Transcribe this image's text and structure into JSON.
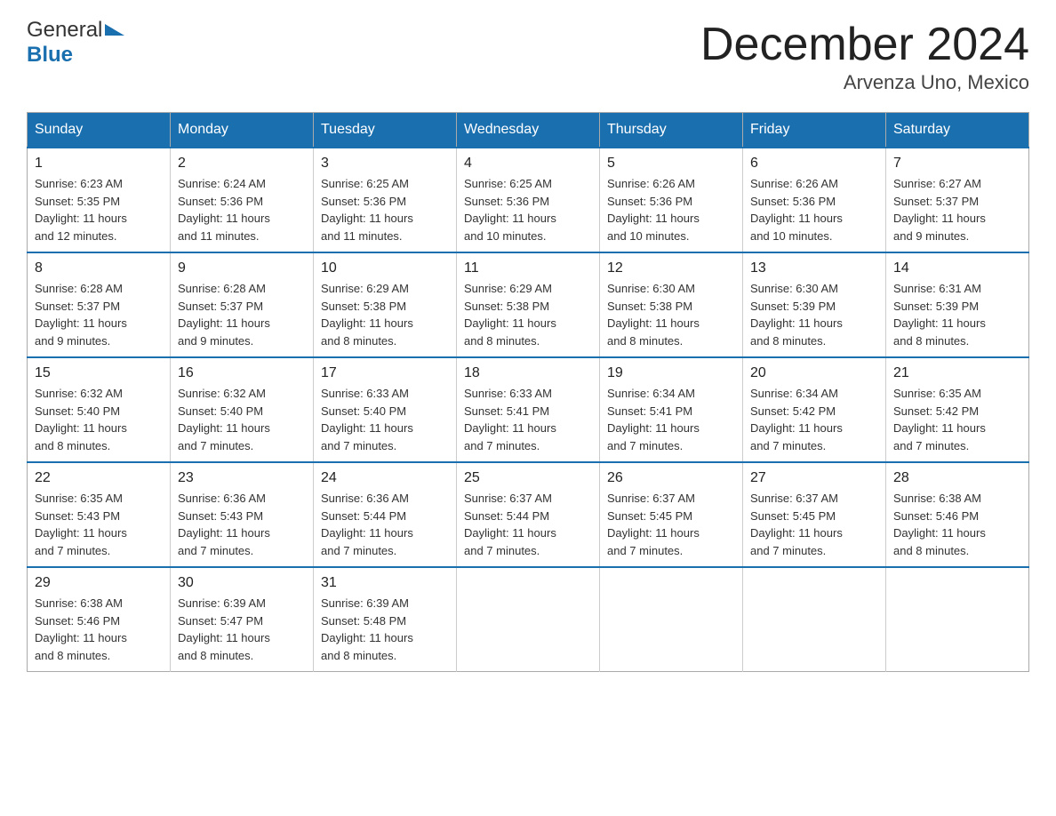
{
  "header": {
    "title": "December 2024",
    "subtitle": "Arvenza Uno, Mexico",
    "logo_general": "General",
    "logo_blue": "Blue"
  },
  "weekdays": [
    "Sunday",
    "Monday",
    "Tuesday",
    "Wednesday",
    "Thursday",
    "Friday",
    "Saturday"
  ],
  "weeks": [
    [
      {
        "day": "1",
        "sunrise": "6:23 AM",
        "sunset": "5:35 PM",
        "daylight": "11 hours and 12 minutes."
      },
      {
        "day": "2",
        "sunrise": "6:24 AM",
        "sunset": "5:36 PM",
        "daylight": "11 hours and 11 minutes."
      },
      {
        "day": "3",
        "sunrise": "6:25 AM",
        "sunset": "5:36 PM",
        "daylight": "11 hours and 11 minutes."
      },
      {
        "day": "4",
        "sunrise": "6:25 AM",
        "sunset": "5:36 PM",
        "daylight": "11 hours and 10 minutes."
      },
      {
        "day": "5",
        "sunrise": "6:26 AM",
        "sunset": "5:36 PM",
        "daylight": "11 hours and 10 minutes."
      },
      {
        "day": "6",
        "sunrise": "6:26 AM",
        "sunset": "5:36 PM",
        "daylight": "11 hours and 10 minutes."
      },
      {
        "day": "7",
        "sunrise": "6:27 AM",
        "sunset": "5:37 PM",
        "daylight": "11 hours and 9 minutes."
      }
    ],
    [
      {
        "day": "8",
        "sunrise": "6:28 AM",
        "sunset": "5:37 PM",
        "daylight": "11 hours and 9 minutes."
      },
      {
        "day": "9",
        "sunrise": "6:28 AM",
        "sunset": "5:37 PM",
        "daylight": "11 hours and 9 minutes."
      },
      {
        "day": "10",
        "sunrise": "6:29 AM",
        "sunset": "5:38 PM",
        "daylight": "11 hours and 8 minutes."
      },
      {
        "day": "11",
        "sunrise": "6:29 AM",
        "sunset": "5:38 PM",
        "daylight": "11 hours and 8 minutes."
      },
      {
        "day": "12",
        "sunrise": "6:30 AM",
        "sunset": "5:38 PM",
        "daylight": "11 hours and 8 minutes."
      },
      {
        "day": "13",
        "sunrise": "6:30 AM",
        "sunset": "5:39 PM",
        "daylight": "11 hours and 8 minutes."
      },
      {
        "day": "14",
        "sunrise": "6:31 AM",
        "sunset": "5:39 PM",
        "daylight": "11 hours and 8 minutes."
      }
    ],
    [
      {
        "day": "15",
        "sunrise": "6:32 AM",
        "sunset": "5:40 PM",
        "daylight": "11 hours and 8 minutes."
      },
      {
        "day": "16",
        "sunrise": "6:32 AM",
        "sunset": "5:40 PM",
        "daylight": "11 hours and 7 minutes."
      },
      {
        "day": "17",
        "sunrise": "6:33 AM",
        "sunset": "5:40 PM",
        "daylight": "11 hours and 7 minutes."
      },
      {
        "day": "18",
        "sunrise": "6:33 AM",
        "sunset": "5:41 PM",
        "daylight": "11 hours and 7 minutes."
      },
      {
        "day": "19",
        "sunrise": "6:34 AM",
        "sunset": "5:41 PM",
        "daylight": "11 hours and 7 minutes."
      },
      {
        "day": "20",
        "sunrise": "6:34 AM",
        "sunset": "5:42 PM",
        "daylight": "11 hours and 7 minutes."
      },
      {
        "day": "21",
        "sunrise": "6:35 AM",
        "sunset": "5:42 PM",
        "daylight": "11 hours and 7 minutes."
      }
    ],
    [
      {
        "day": "22",
        "sunrise": "6:35 AM",
        "sunset": "5:43 PM",
        "daylight": "11 hours and 7 minutes."
      },
      {
        "day": "23",
        "sunrise": "6:36 AM",
        "sunset": "5:43 PM",
        "daylight": "11 hours and 7 minutes."
      },
      {
        "day": "24",
        "sunrise": "6:36 AM",
        "sunset": "5:44 PM",
        "daylight": "11 hours and 7 minutes."
      },
      {
        "day": "25",
        "sunrise": "6:37 AM",
        "sunset": "5:44 PM",
        "daylight": "11 hours and 7 minutes."
      },
      {
        "day": "26",
        "sunrise": "6:37 AM",
        "sunset": "5:45 PM",
        "daylight": "11 hours and 7 minutes."
      },
      {
        "day": "27",
        "sunrise": "6:37 AM",
        "sunset": "5:45 PM",
        "daylight": "11 hours and 7 minutes."
      },
      {
        "day": "28",
        "sunrise": "6:38 AM",
        "sunset": "5:46 PM",
        "daylight": "11 hours and 8 minutes."
      }
    ],
    [
      {
        "day": "29",
        "sunrise": "6:38 AM",
        "sunset": "5:46 PM",
        "daylight": "11 hours and 8 minutes."
      },
      {
        "day": "30",
        "sunrise": "6:39 AM",
        "sunset": "5:47 PM",
        "daylight": "11 hours and 8 minutes."
      },
      {
        "day": "31",
        "sunrise": "6:39 AM",
        "sunset": "5:48 PM",
        "daylight": "11 hours and 8 minutes."
      },
      null,
      null,
      null,
      null
    ]
  ],
  "labels": {
    "sunrise": "Sunrise:",
    "sunset": "Sunset:",
    "daylight": "Daylight:"
  }
}
